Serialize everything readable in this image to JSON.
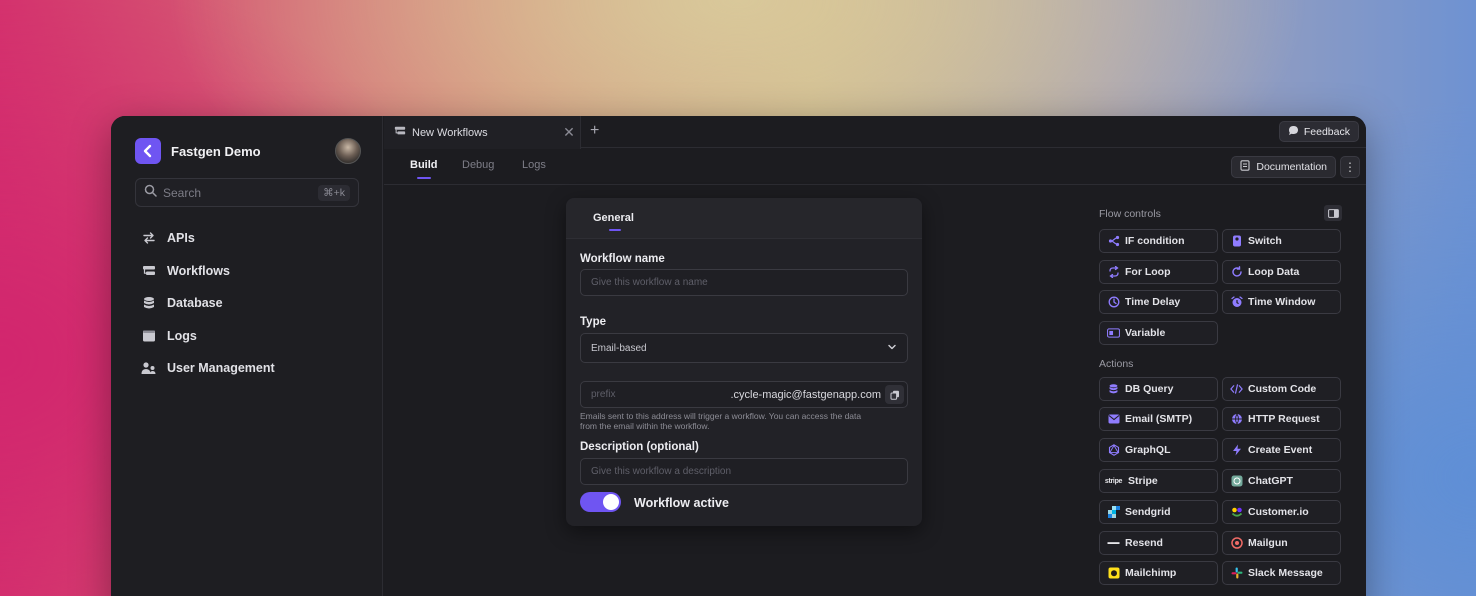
{
  "colors": {
    "accent": "#6f55f2",
    "window_bg": "#1c1c20"
  },
  "sidebar": {
    "app_name": "Fastgen Demo",
    "search": {
      "placeholder": "Search",
      "shortcut": "⌘+k"
    },
    "items": [
      {
        "label": "APIs",
        "icon": "arrows-swap-icon"
      },
      {
        "label": "Workflows",
        "icon": "workflow-icon"
      },
      {
        "label": "Database",
        "icon": "database-icon"
      },
      {
        "label": "Logs",
        "icon": "logs-icon"
      },
      {
        "label": "User Management",
        "icon": "users-icon"
      }
    ]
  },
  "tabs": {
    "active_tab": "New Workflows",
    "feedback": "Feedback"
  },
  "subtabs": {
    "build": "Build",
    "debug": "Debug",
    "logs": "Logs",
    "documentation": "Documentation",
    "more": "⋮"
  },
  "form": {
    "section_tab": "General",
    "name_label": "Workflow name",
    "name_placeholder": "Give this workflow a name",
    "type_label": "Type",
    "type_value": "Email-based",
    "prefix_placeholder": "prefix",
    "email_suffix": ".cycle-magic@fastgenapp.com",
    "help_line1": "Emails sent to this address will trigger a workflow. You can access the data",
    "help_line2": "from the email within the workflow.",
    "desc_label": "Description (optional)",
    "desc_placeholder": "Give this workflow a description",
    "active_label": "Workflow active",
    "active": true
  },
  "panel": {
    "flow_title": "Flow controls",
    "flow": [
      {
        "label": "IF condition",
        "icon": "branch-icon"
      },
      {
        "label": "Switch",
        "icon": "switch-icon"
      },
      {
        "label": "For Loop",
        "icon": "loop-icon"
      },
      {
        "label": "Loop Data",
        "icon": "refresh-icon"
      },
      {
        "label": "Time Delay",
        "icon": "timer-icon"
      },
      {
        "label": "Time Window",
        "icon": "alarm-icon"
      },
      {
        "label": "Variable",
        "icon": "variable-icon"
      }
    ],
    "actions_title": "Actions",
    "actions": [
      {
        "label": "DB Query",
        "icon": "database-icon"
      },
      {
        "label": "Custom Code",
        "icon": "code-icon"
      },
      {
        "label": "Email (SMTP)",
        "icon": "mail-icon"
      },
      {
        "label": "HTTP Request",
        "icon": "globe-icon"
      },
      {
        "label": "GraphQL",
        "icon": "graphql-icon"
      },
      {
        "label": "Create Event",
        "icon": "bolt-icon"
      },
      {
        "label": "Stripe",
        "icon": "stripe-logo-icon"
      },
      {
        "label": "ChatGPT",
        "icon": "chatgpt-logo-icon"
      },
      {
        "label": "Sendgrid",
        "icon": "sendgrid-logo-icon"
      },
      {
        "label": "Customer.io",
        "icon": "customerio-logo-icon"
      },
      {
        "label": "Resend",
        "icon": "resend-logo-icon"
      },
      {
        "label": "Mailgun",
        "icon": "mailgun-logo-icon"
      },
      {
        "label": "Mailchimp",
        "icon": "mailchimp-logo-icon"
      },
      {
        "label": "Slack Message",
        "icon": "slack-logo-icon"
      }
    ]
  }
}
